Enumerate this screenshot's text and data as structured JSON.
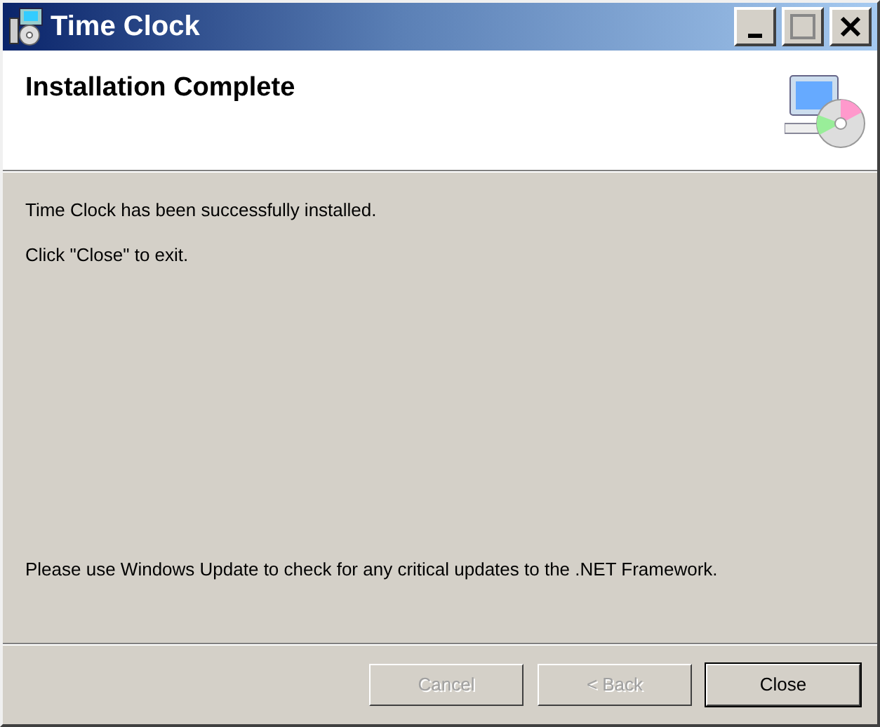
{
  "window": {
    "title": "Time Clock"
  },
  "header": {
    "title": "Installation Complete"
  },
  "messages": [
    "Time Clock has been successfully installed.",
    "Click \"Close\" to exit."
  ],
  "footnote": "Please use Windows Update to check for any critical updates to the .NET Framework.",
  "buttons": [
    {
      "label": "Cancel",
      "disabled": true,
      "default": false
    },
    {
      "label": "< Back",
      "disabled": true,
      "default": false
    },
    {
      "label": "Close",
      "disabled": false,
      "default": true
    }
  ]
}
